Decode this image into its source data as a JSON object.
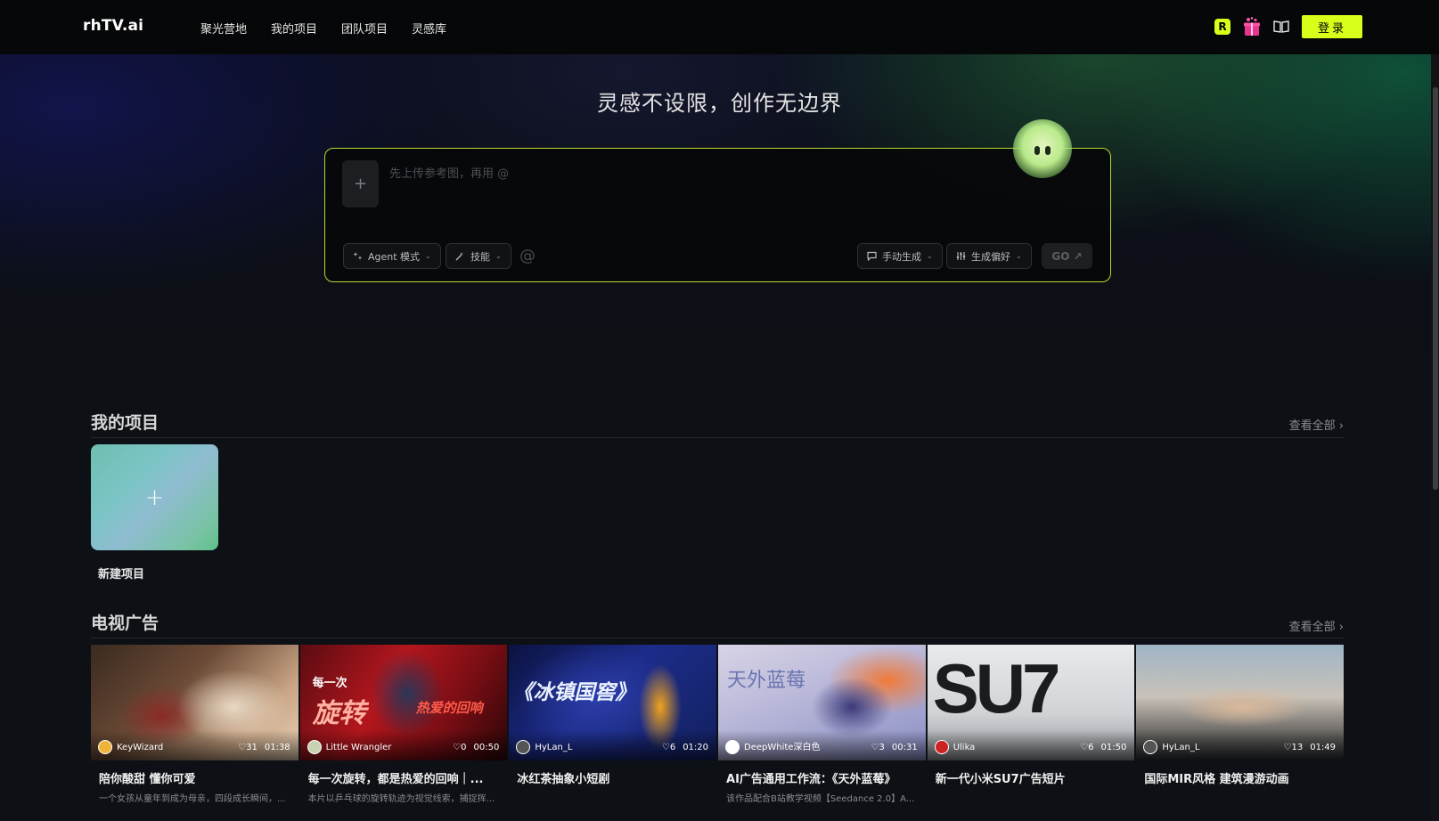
{
  "nav": {
    "logo": "rhTV.ai",
    "links": [
      "聚光营地",
      "我的项目",
      "团队项目",
      "灵感库"
    ],
    "r_badge": "R",
    "login_label": "登录"
  },
  "hero": {
    "title": "灵感不设限，创作无边界",
    "placeholder": "先上传参考图，再用 @",
    "upload_symbol": "+",
    "agent_mode": "Agent 模式",
    "skills": "技能",
    "at_symbol": "@",
    "manual_generate": "手动生成",
    "preference": "生成偏好",
    "go_label": "GO ↗"
  },
  "my_projects": {
    "title": "我的项目",
    "see_all": "查看全部 ›",
    "new_symbol": "+",
    "new_label": "新建项目"
  },
  "tv_ads": {
    "title": "电视广告",
    "see_all": "查看全部 ›",
    "cards": [
      {
        "author": "KeyWizard",
        "likes": "31",
        "duration": "01:38",
        "title": "陪你酸甜 懂你可爱",
        "desc": "一个女孩从童年到成为母亲，四段成长瞬间，..."
      },
      {
        "author": "Little Wrangler",
        "likes": "0",
        "duration": "00:50",
        "title": "每一次旋转，都是热爱的回响｜...",
        "desc": "本片以乒乓球的旋转轨迹为视觉线索，捕捉挥..."
      },
      {
        "author": "HyLan_L",
        "likes": "6",
        "duration": "01:20",
        "title": "冰红茶抽象小短剧",
        "desc": ""
      },
      {
        "author": "DeepWhite深白色",
        "likes": "3",
        "duration": "00:31",
        "title": "AI广告通用工作流：《天外蓝莓》",
        "desc": "该作品配合B站教学视频【Seedance 2.0】A..."
      },
      {
        "author": "Ulika",
        "likes": "6",
        "duration": "01:50",
        "title": "新一代小米SU7广告短片",
        "desc": ""
      },
      {
        "author": "HyLan_L",
        "likes": "13",
        "duration": "01:49",
        "title": "国际MIR风格 建筑漫游动画",
        "desc": ""
      }
    ],
    "thumb_texts": {
      "c2_big": "旋转",
      "c2_small": "每一次",
      "c2_right": "热爱的回响",
      "c3_big": "《冰镇国窖》",
      "c4_big": "天外蓝莓",
      "c5_big": "SU7"
    }
  },
  "colors": {
    "accent": "#d6ff1a",
    "background": "#0d1014",
    "nav_bg": "#060708"
  }
}
